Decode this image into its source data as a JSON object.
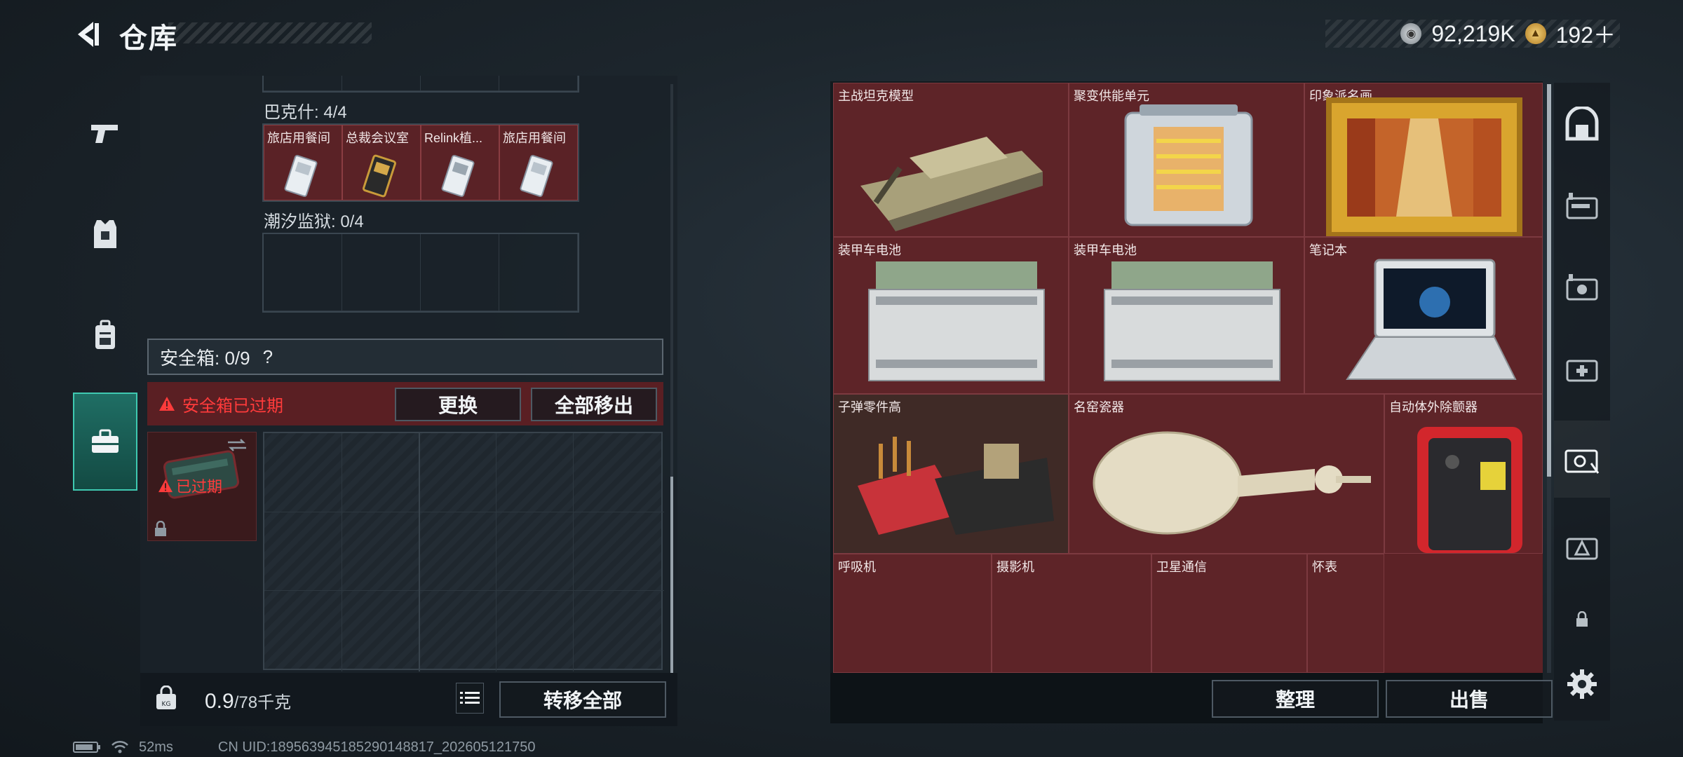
{
  "header": {
    "title": "仓库",
    "currency": {
      "coins": "92,219K",
      "tickets": "192＋"
    }
  },
  "left_nav": {
    "items": [
      {
        "name": "weapons",
        "icon": "pistol-icon"
      },
      {
        "name": "armor",
        "icon": "vest-icon"
      },
      {
        "name": "backpack",
        "icon": "backpack-icon"
      },
      {
        "name": "safebox",
        "icon": "toolbox-icon",
        "active": true
      }
    ]
  },
  "keys": {
    "section1_label": "巴克什: 4/4",
    "cards": [
      {
        "name": "旅店用餐间"
      },
      {
        "name": "总裁会议室"
      },
      {
        "name": "Relink植..."
      },
      {
        "name": "旅店用餐间"
      }
    ],
    "section2_label": "潮汐监狱: 0/4"
  },
  "safebox": {
    "label": "安全箱: 0/9",
    "help": "?",
    "expired_notice": "安全箱已过期",
    "replace_button": "更换",
    "remove_all_button": "全部移出",
    "thumb_status": "已过期"
  },
  "footer_left": {
    "weight": "0.9",
    "weight_unit": "/78千克",
    "transfer_all_button": "转移全部"
  },
  "stash": {
    "items": [
      {
        "name": "主战坦克模型"
      },
      {
        "name": "聚变供能单元"
      },
      {
        "name": "印象派名画"
      },
      {
        "name": "装甲车电池"
      },
      {
        "name": "装甲车电池"
      },
      {
        "name": "笔记本"
      },
      {
        "name": "子弹零件高"
      },
      {
        "name": "名窑瓷器"
      },
      {
        "name": "自动体外除颤器"
      },
      {
        "name": "呼吸机"
      },
      {
        "name": "摄影机"
      },
      {
        "name": "卫星通信"
      },
      {
        "name": "怀表"
      }
    ],
    "sort_button": "整理",
    "sell_button": "出售"
  },
  "status_bar": {
    "ping": "52ms",
    "uid": "CN UID:18956394518529014881​7_202605121750"
  },
  "colors": {
    "accent": "#3fc9b1",
    "item_bg": "#5e2428",
    "warning": "#ff3b3b"
  }
}
